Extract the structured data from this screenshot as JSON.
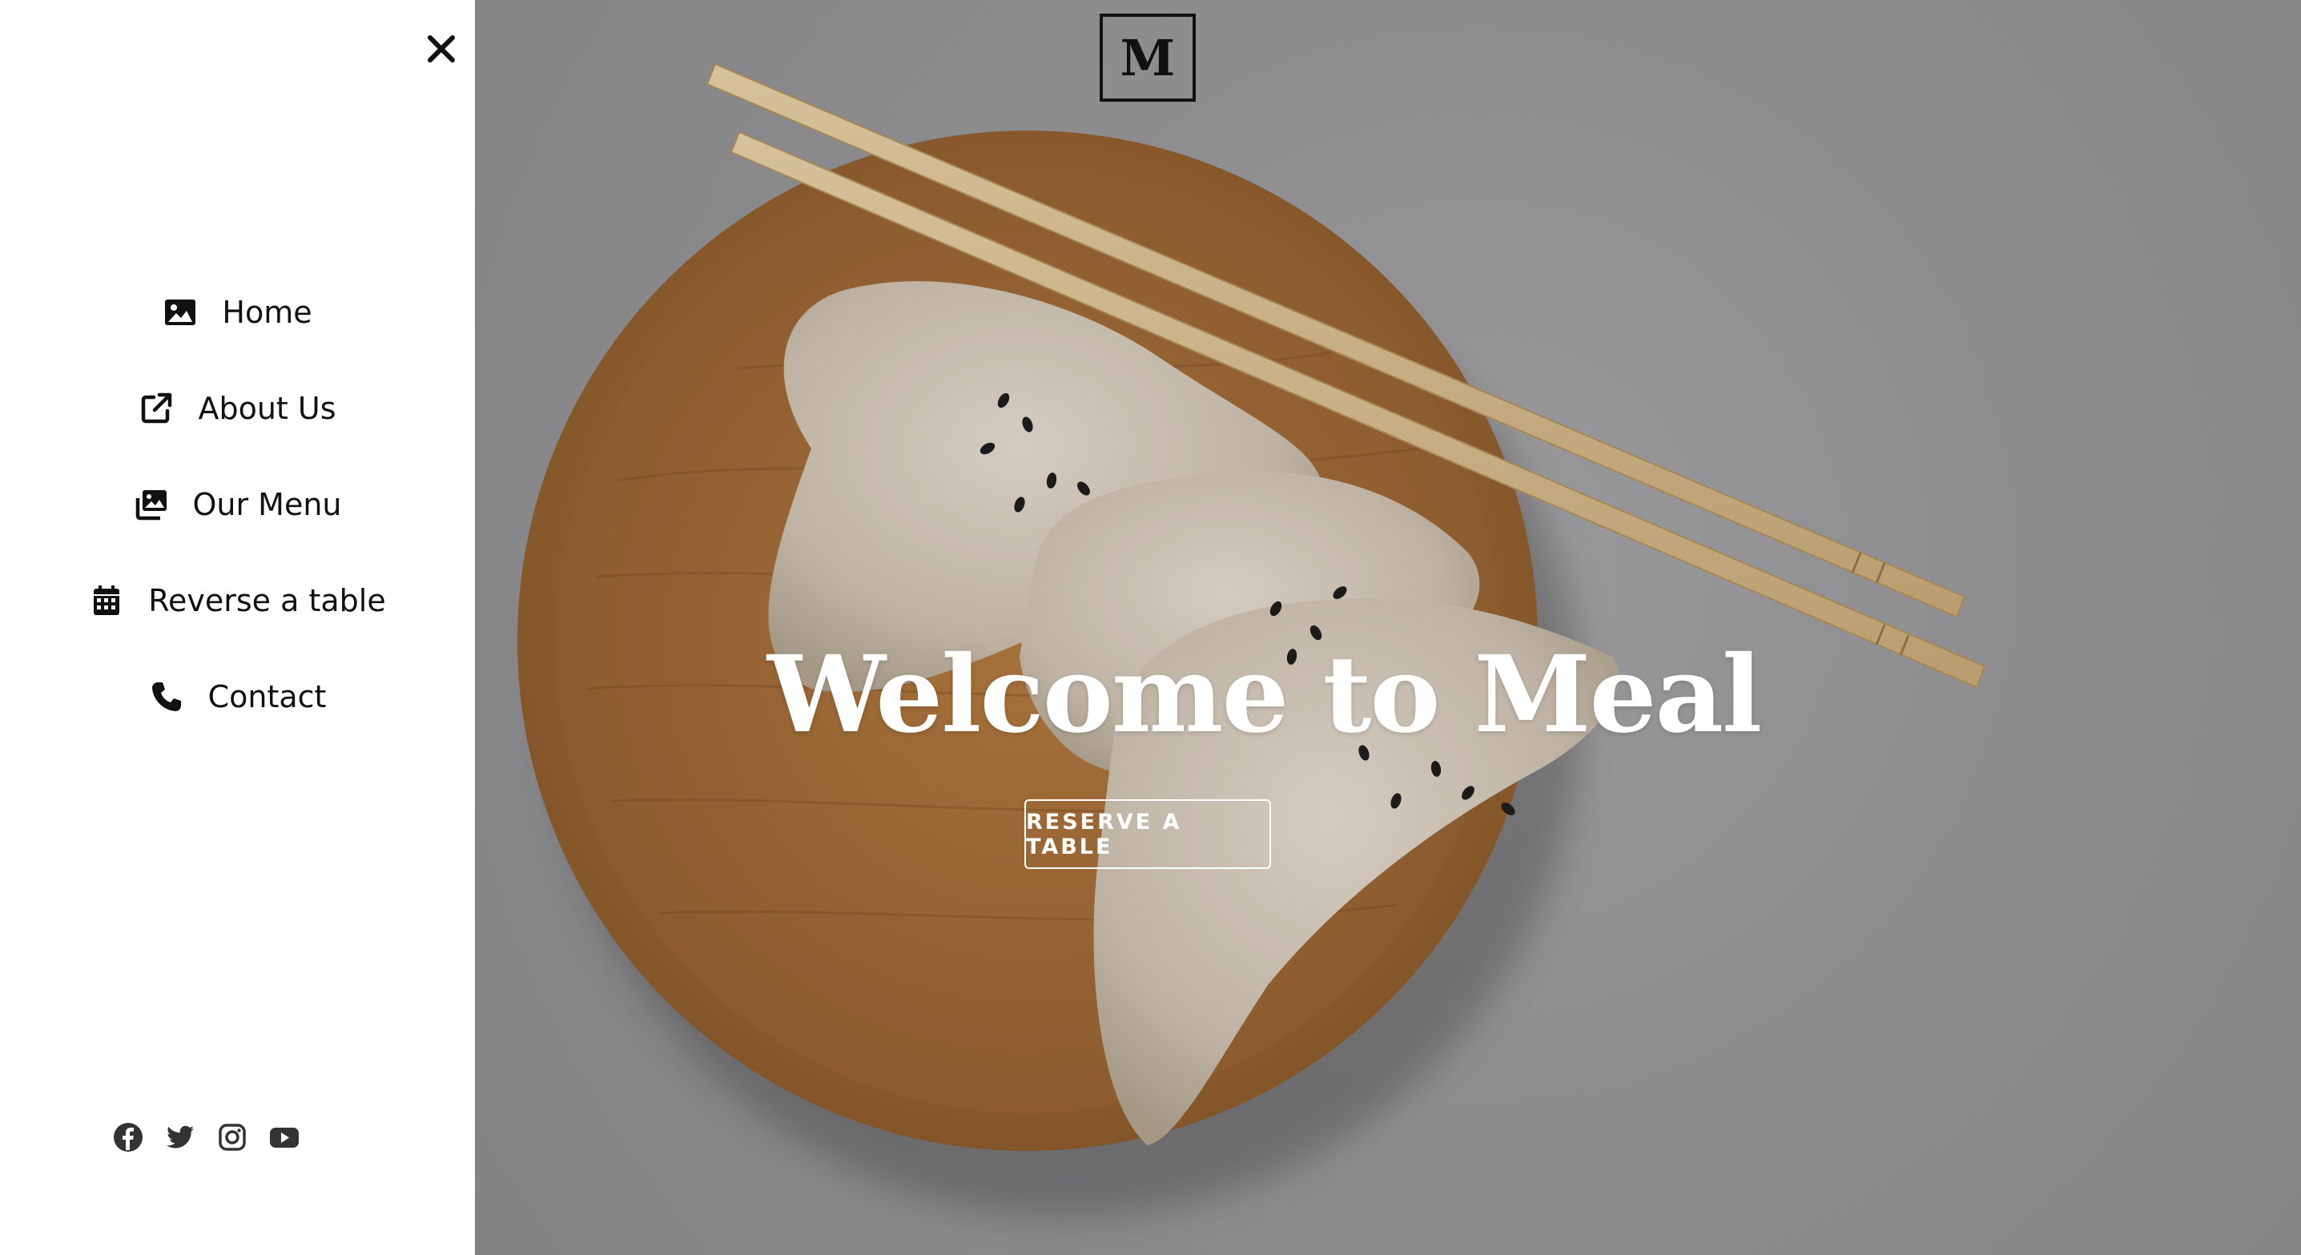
{
  "brand": {
    "logo_letter": "M"
  },
  "sidebar": {
    "close_icon": "close-icon",
    "items": [
      {
        "label": "Home",
        "icon": "image-icon"
      },
      {
        "label": "About Us",
        "icon": "external-link-icon"
      },
      {
        "label": "Our Menu",
        "icon": "photos-icon"
      },
      {
        "label": "Reverse a table",
        "icon": "calendar-icon"
      },
      {
        "label": "Contact",
        "icon": "phone-icon"
      }
    ],
    "social": [
      "facebook-icon",
      "twitter-icon",
      "instagram-icon",
      "youtube-icon"
    ]
  },
  "hero": {
    "title": "Welcome to Meal",
    "cta_label": "RESERVE A TABLE"
  },
  "colors": {
    "sidebar_bg": "#ffffff",
    "text_dark": "#111111",
    "hero_text": "#ffffff",
    "plate_wood": "#b9834a"
  }
}
